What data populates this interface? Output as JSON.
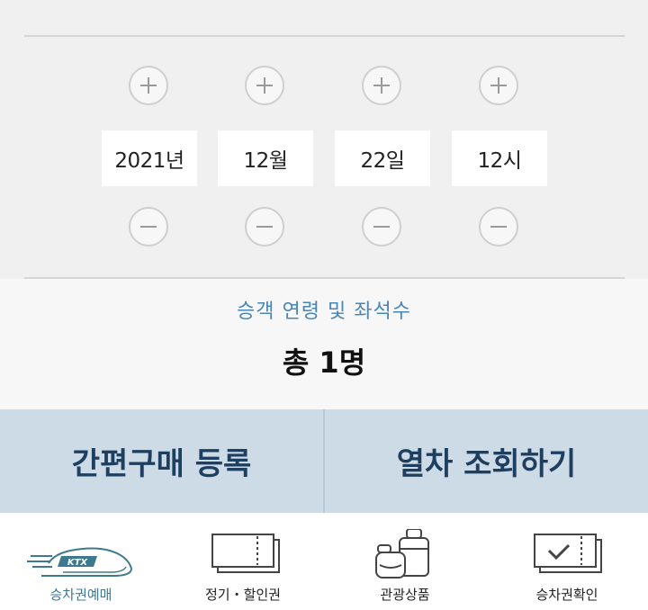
{
  "datetime": {
    "year": "2021년",
    "month": "12월",
    "day": "22일",
    "hour": "12시"
  },
  "passenger": {
    "label": "승객 연령 및 좌석수",
    "total": "총 1명"
  },
  "actions": {
    "quick_purchase_label": "간편구매 등록",
    "search_train_label": "열차 조회하기"
  },
  "tabs": [
    {
      "label": "승차권예매",
      "icon": "ktx-train-icon",
      "active": true
    },
    {
      "label": "정기・할인권",
      "icon": "pass-ticket-icon",
      "active": false
    },
    {
      "label": "관광상품",
      "icon": "luggage-icon",
      "active": false
    },
    {
      "label": "승차권확인",
      "icon": "ticket-check-icon",
      "active": false
    }
  ],
  "colors": {
    "accent_text": "#4a86b5",
    "action_bg": "#cddbe7",
    "action_text": "#1e3f5f",
    "active_tab": "#3d7a8f"
  }
}
